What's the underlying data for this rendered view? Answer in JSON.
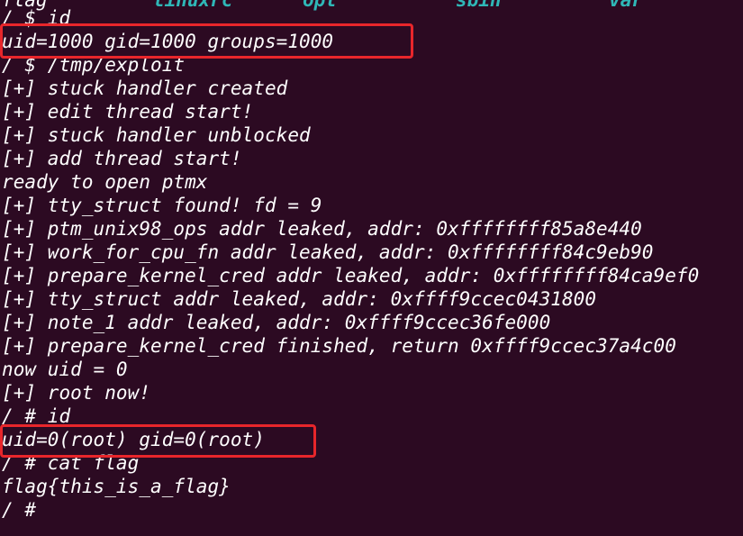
{
  "terminal": {
    "top_row": [
      "flag",
      "linuxrc",
      "opt",
      "sbin",
      "var"
    ],
    "lines": [
      "/ $ id",
      "uid=1000 gid=1000 groups=1000",
      "/ $ /tmp/exploit",
      "[+] stuck handler created",
      "[+] edit thread start!",
      "[+] stuck handler unblocked",
      "[+] add thread start!",
      "ready to open ptmx",
      "[+] tty_struct found! fd = 9",
      "[+] ptm_unix98_ops addr leaked, addr: 0xffffffff85a8e440",
      "[+] work_for_cpu_fn addr leaked, addr: 0xffffffff84c9eb90",
      "[+] prepare_kernel_cred addr leaked, addr: 0xffffffff84ca9ef0",
      "[+] tty_struct addr leaked, addr: 0xffff9ccec0431800",
      "[+] note_1 addr leaked, addr: 0xffff9ccec36fe000",
      "[+] prepare_kernel_cred finished, return 0xffff9ccec37a4c00",
      "now uid = 0",
      "[+] root now!",
      "/ # id",
      "uid=0(root) gid=0(root)",
      "/ # cat flag",
      "flag{this_is_a_flag}",
      "/ #"
    ]
  },
  "colors": {
    "background": "#2c0a22",
    "text": "#ffffff",
    "directory": "#2fb7b7",
    "highlight_box": "#e8262b"
  }
}
